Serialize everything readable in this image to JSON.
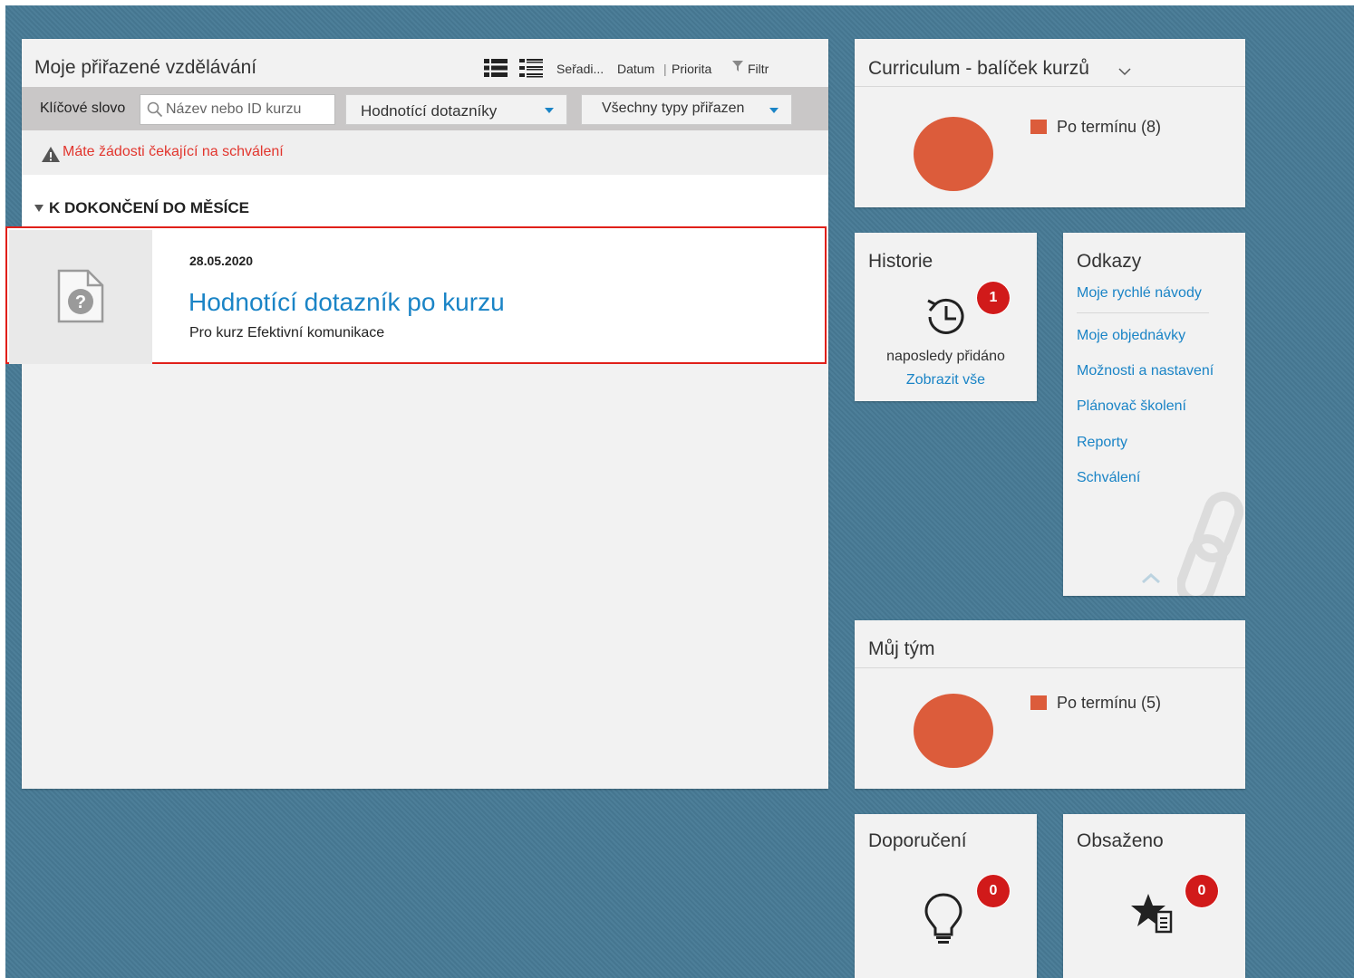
{
  "main": {
    "title": "Moje přiřazené vzdělávání",
    "sort_label": "Seřadi...",
    "sort_date": "Datum",
    "sort_separator": "|",
    "sort_priority": "Priorita",
    "filter_label": "Filtr",
    "keyword_label": "Klíčové slovo",
    "search_placeholder": "Název nebo ID kurzu",
    "dropdown_type": "Hodnotící dotazníky",
    "dropdown_assignment": "Všechny typy přiřazen",
    "warning": "Máte žádosti čekající na schválení",
    "section_title": "K DOKONČENÍ DO MĚSÍCE",
    "item": {
      "date": "28.05.2020",
      "title": "Hodnotící dotazník po kurzu",
      "subtitle": "Pro kurz Efektivní komunikace"
    }
  },
  "curriculum": {
    "title": "Curriculum - balíček kurzů",
    "legend": "Po termínu (8)",
    "color": "#dc5c3b"
  },
  "history": {
    "title": "Historie",
    "badge": "1",
    "caption": "naposledy přidáno",
    "link": "Zobrazit vše"
  },
  "links": {
    "title": "Odkazy",
    "items": [
      "Moje rychlé návody",
      "Moje objednávky",
      "Možnosti a nastavení",
      "Plánovač školení",
      "Reporty",
      "Schválení"
    ]
  },
  "team": {
    "title": "Můj tým",
    "legend": "Po termínu (5)",
    "color": "#dc5c3b"
  },
  "recommendations": {
    "title": "Doporučení",
    "badge": "0"
  },
  "contained": {
    "title": "Obsaženo",
    "badge": "0"
  }
}
